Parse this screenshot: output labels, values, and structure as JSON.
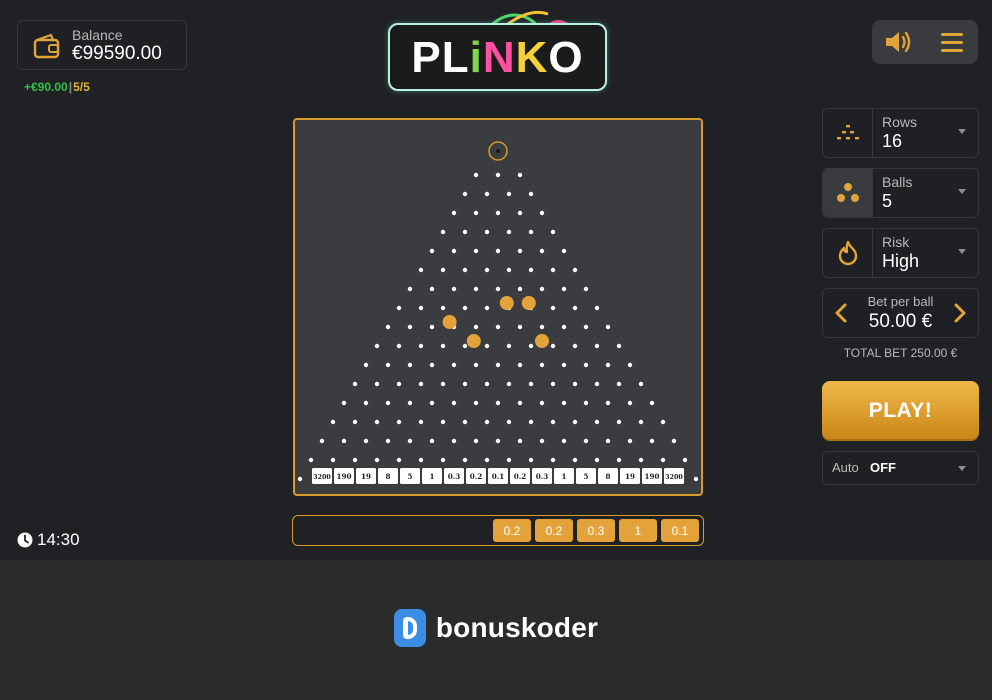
{
  "balance": {
    "label": "Balance",
    "value": "€99590.00"
  },
  "last_win": {
    "amount": "+€90.00",
    "separator": "|",
    "balls": "5/5"
  },
  "logo": {
    "text": "PLiNKO"
  },
  "board": {
    "rows": 16,
    "multipliers": [
      "3200",
      "190",
      "19",
      "8",
      "5",
      "1",
      "0.3",
      "0.2",
      "0.1",
      "0.2",
      "0.3",
      "1",
      "5",
      "8",
      "19",
      "190",
      "3200"
    ],
    "balls_in_flight": [
      {
        "row": 8,
        "pos": 2.8
      },
      {
        "row": 7,
        "pos": 4.9
      },
      {
        "row": 7,
        "pos": 5.9
      },
      {
        "row": 9,
        "pos": 4.4
      },
      {
        "row": 9,
        "pos": 7.5
      }
    ]
  },
  "history": [
    "0.2",
    "0.2",
    "0.3",
    "1",
    "0.1"
  ],
  "clock": "14:30",
  "settings": {
    "rows": {
      "label": "Rows",
      "value": "16"
    },
    "balls": {
      "label": "Balls",
      "value": "5"
    },
    "risk": {
      "label": "Risk",
      "value": "High"
    }
  },
  "bet": {
    "label": "Bet per ball",
    "value": "50.00 €",
    "total": "TOTAL BET 250.00 €"
  },
  "play_label": "PLAY!",
  "auto": {
    "label": "Auto",
    "value": "OFF"
  },
  "footer": {
    "brand": "bonuskoder"
  },
  "colors": {
    "accent": "#e4a23b",
    "board_bg": "#3a3c40",
    "win_green": "#31c24a",
    "brand_blue": "#3a8ee6"
  },
  "icons": {
    "wallet": "wallet-icon",
    "sound": "speaker-icon",
    "menu": "hamburger-icon",
    "rows": "pyramid-icon",
    "balls": "three-balls-icon",
    "risk": "flame-icon",
    "clock": "clock-icon"
  }
}
